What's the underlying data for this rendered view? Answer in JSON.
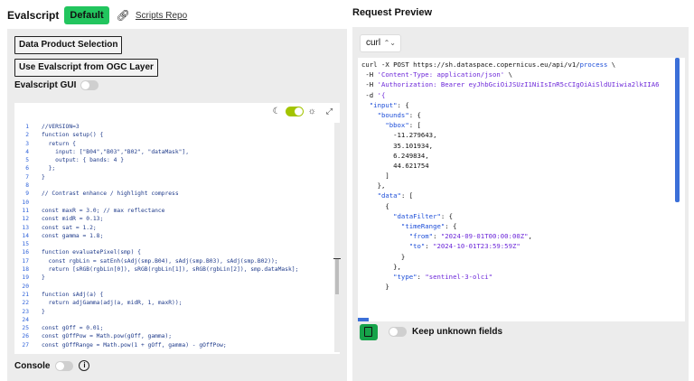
{
  "left": {
    "title": "Evalscript",
    "badge": "Default",
    "link_label": "Scripts Repo",
    "buttons": {
      "data_product": "Data Product Selection",
      "use_ogc": "Use Evalscript from OGC Layer"
    },
    "gui_label": "Evalscript GUI",
    "console_label": "Console",
    "code_lines": [
      {
        "n": "1",
        "t": "//VERSION=3"
      },
      {
        "n": "2",
        "t": "function setup() {"
      },
      {
        "n": "3",
        "t": "  return {"
      },
      {
        "n": "4",
        "t": "    input: [\"B04\",\"B03\",\"B02\", \"dataMask\"],"
      },
      {
        "n": "5",
        "t": "    output: { bands: 4 }"
      },
      {
        "n": "6",
        "t": "  };"
      },
      {
        "n": "7",
        "t": "}"
      },
      {
        "n": "8",
        "t": ""
      },
      {
        "n": "9",
        "t": "// Contrast enhance / highlight compress"
      },
      {
        "n": "10",
        "t": ""
      },
      {
        "n": "11",
        "t": "const maxR = 3.0; // max reflectance"
      },
      {
        "n": "12",
        "t": "const midR = 0.13;"
      },
      {
        "n": "13",
        "t": "const sat = 1.2;"
      },
      {
        "n": "14",
        "t": "const gamma = 1.8;"
      },
      {
        "n": "15",
        "t": ""
      },
      {
        "n": "16",
        "t": "function evaluatePixel(smp) {"
      },
      {
        "n": "17",
        "t": "  const rgbLin = satEnh(sAdj(smp.B04), sAdj(smp.B03), sAdj(smp.B02));"
      },
      {
        "n": "18",
        "t": "  return [sRGB(rgbLin[0]), sRGB(rgbLin[1]), sRGB(rgbLin[2]), smp.dataMask];"
      },
      {
        "n": "19",
        "t": "}"
      },
      {
        "n": "20",
        "t": ""
      },
      {
        "n": "21",
        "t": "function sAdj(a) {"
      },
      {
        "n": "22",
        "t": "  return adjGamma(adj(a, midR, 1, maxR));"
      },
      {
        "n": "23",
        "t": "}"
      },
      {
        "n": "24",
        "t": ""
      },
      {
        "n": "25",
        "t": "const gOff = 0.01;"
      },
      {
        "n": "26",
        "t": "const gOffPow = Math.pow(gOff, gamma);"
      },
      {
        "n": "27",
        "t": "const gOffRange = Math.pow(1 + gOff, gamma) - gOffPow;"
      }
    ]
  },
  "right": {
    "title": "Request Preview",
    "select_value": "curl",
    "keep_label": "Keep unknown fields",
    "preview_lines": [
      {
        "segs": [
          {
            "c": "pv-num",
            "t": "curl -X POST https://sh.dataspace.copernicus.eu/api/v1/"
          },
          {
            "c": "pv-key",
            "t": "process"
          },
          {
            "c": "pv-num",
            "t": " \\"
          }
        ]
      },
      {
        "segs": [
          {
            "c": "pv-num",
            "t": " -H "
          },
          {
            "c": "pv-str",
            "t": "'Content-Type: application/json'"
          },
          {
            "c": "pv-num",
            "t": " \\"
          }
        ]
      },
      {
        "segs": [
          {
            "c": "pv-num",
            "t": " -H "
          },
          {
            "c": "pv-str",
            "t": "'Authorization: Bearer eyJhbGciOiJSUzI1NiIsInR5cCIgOiAiSldUIiwia2lkIIA6"
          }
        ]
      },
      {
        "segs": [
          {
            "c": "pv-num",
            "t": " -d "
          },
          {
            "c": "pv-str",
            "t": "'{"
          }
        ]
      },
      {
        "segs": [
          {
            "c": "pv-key",
            "t": "  \"input\""
          },
          {
            "c": "pv-num",
            "t": ": {"
          }
        ]
      },
      {
        "segs": [
          {
            "c": "pv-key",
            "t": "    \"bounds\""
          },
          {
            "c": "pv-num",
            "t": ": {"
          }
        ]
      },
      {
        "segs": [
          {
            "c": "pv-key",
            "t": "      \"bbox\""
          },
          {
            "c": "pv-num",
            "t": ": ["
          }
        ]
      },
      {
        "segs": [
          {
            "c": "pv-num",
            "t": "        -11.279643,"
          }
        ]
      },
      {
        "segs": [
          {
            "c": "pv-num",
            "t": "        35.101934,"
          }
        ]
      },
      {
        "segs": [
          {
            "c": "pv-num",
            "t": "        6.249834,"
          }
        ]
      },
      {
        "segs": [
          {
            "c": "pv-num",
            "t": "        44.621754"
          }
        ]
      },
      {
        "segs": [
          {
            "c": "pv-num",
            "t": "      ]"
          }
        ]
      },
      {
        "segs": [
          {
            "c": "pv-num",
            "t": "    },"
          }
        ]
      },
      {
        "segs": [
          {
            "c": "pv-key",
            "t": "    \"data\""
          },
          {
            "c": "pv-num",
            "t": ": ["
          }
        ]
      },
      {
        "segs": [
          {
            "c": "pv-num",
            "t": "      {"
          }
        ]
      },
      {
        "segs": [
          {
            "c": "pv-key",
            "t": "        \"dataFilter\""
          },
          {
            "c": "pv-num",
            "t": ": {"
          }
        ]
      },
      {
        "segs": [
          {
            "c": "pv-key",
            "t": "          \"timeRange\""
          },
          {
            "c": "pv-num",
            "t": ": {"
          }
        ]
      },
      {
        "segs": [
          {
            "c": "pv-key",
            "t": "            \"from\""
          },
          {
            "c": "pv-num",
            "t": ": "
          },
          {
            "c": "pv-str",
            "t": "\"2024-09-01T00:00:00Z\""
          },
          {
            "c": "pv-num",
            "t": ","
          }
        ]
      },
      {
        "segs": [
          {
            "c": "pv-key",
            "t": "            \"to\""
          },
          {
            "c": "pv-num",
            "t": ": "
          },
          {
            "c": "pv-str",
            "t": "\"2024-10-01T23:59:59Z\""
          }
        ]
      },
      {
        "segs": [
          {
            "c": "pv-num",
            "t": "          }"
          }
        ]
      },
      {
        "segs": [
          {
            "c": "pv-num",
            "t": "        },"
          }
        ]
      },
      {
        "segs": [
          {
            "c": "pv-key",
            "t": "        \"type\""
          },
          {
            "c": "pv-num",
            "t": ": "
          },
          {
            "c": "pv-str",
            "t": "\"sentinel-3-olci\""
          }
        ]
      },
      {
        "segs": [
          {
            "c": "pv-num",
            "t": "      }"
          }
        ]
      }
    ]
  },
  "colors": {
    "badge": "#22c55e",
    "theme_toggle": "#a3c400",
    "accent": "#3b6fd8",
    "copy_button": "#16a34a"
  },
  "icons": {
    "link": "link-icon",
    "theme": "moon-icon",
    "sun": "sun-icon",
    "fullscreen": "expand-icon",
    "info": "info-icon",
    "copy": "copy-icon",
    "chevron": "chevron-updown-icon"
  }
}
